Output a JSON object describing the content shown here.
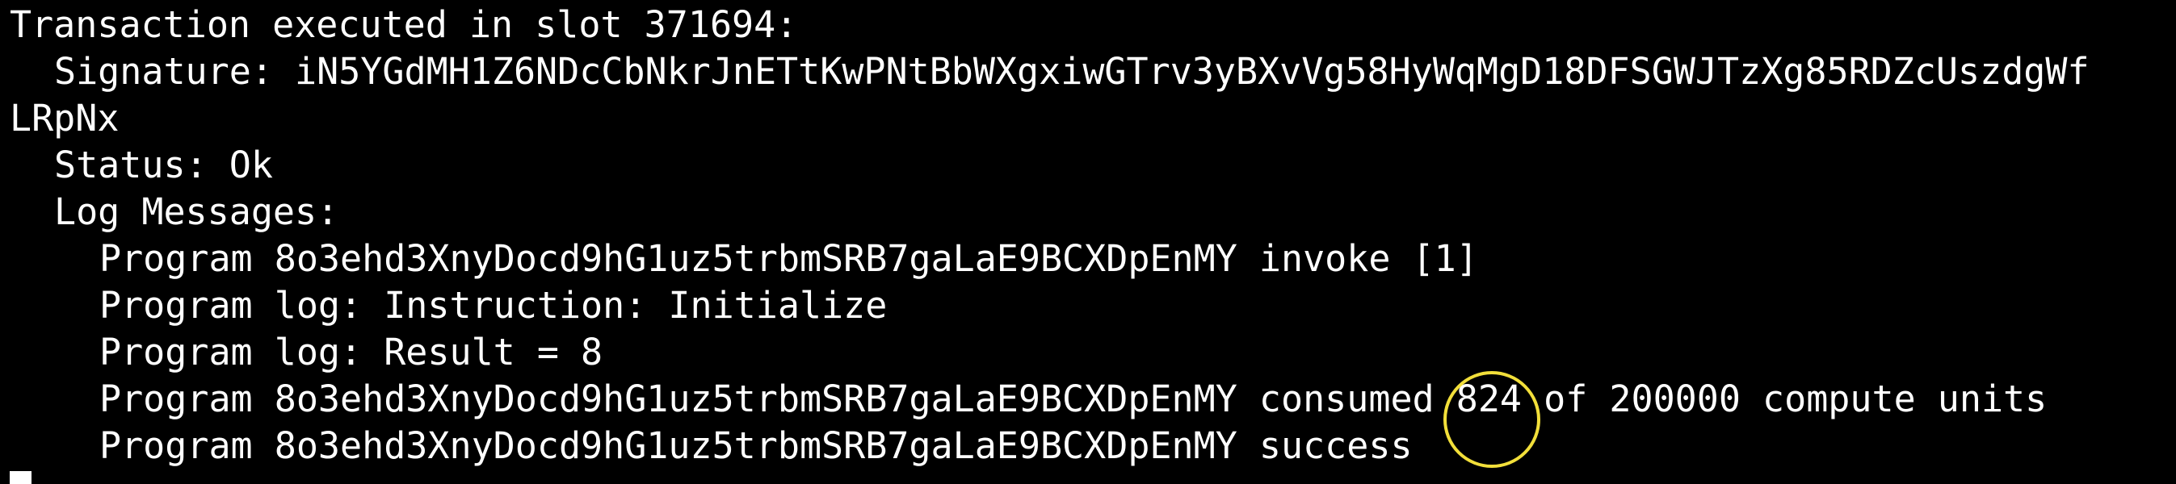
{
  "terminal": {
    "line1": "Transaction executed in slot 371694:",
    "signature_line": "Signature: iN5YGdMH1Z6NDcCbNkrJnETtKwPNtBbWXgxiwGTrv3yBXvVg58HyWqMgD18DFSGWJTzXg85RDZcUszdgWf",
    "signature_wrap": "LRpNx",
    "status_line": "Status: Ok",
    "log_header": "Log Messages:",
    "log1": "Program 8o3ehd3XnyDocd9hG1uz5trbmSRB7gaLaE9BCXDpEnMY invoke [1]",
    "log2": "Program log: Instruction: Initialize",
    "log3": "Program log: Result = 8",
    "log4_prefix": "Program 8o3ehd3XnyDocd9hG1uz5trbmSRB7gaLaE9BCXDpEnMY consumed ",
    "log4_value": "824",
    "log4_suffix": " of 200000 compute units",
    "log5": "Program 8o3ehd3XnyDocd9hG1uz5trbmSRB7gaLaE9BCXDpEnMY success"
  },
  "colors": {
    "background": "#000000",
    "text": "#ffffff",
    "highlight_circle": "#f2df3a"
  }
}
